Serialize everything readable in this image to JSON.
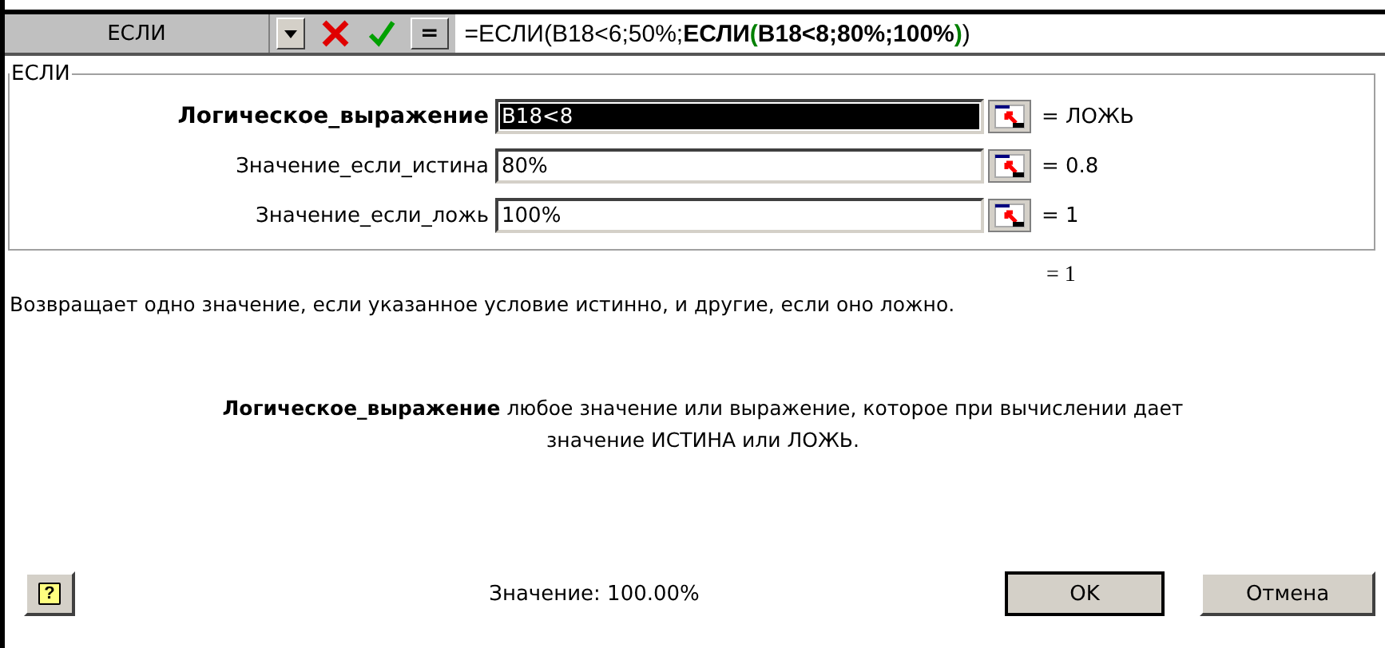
{
  "name_box": {
    "value": "ЕСЛИ"
  },
  "formula_bar": {
    "cancel_icon": true,
    "enter_icon": true,
    "equals": "=",
    "segments": [
      {
        "text": "=ЕСЛИ(B18<6;50%;",
        "bold": false
      },
      {
        "text": "ЕСЛИ",
        "bold": true
      },
      {
        "text": "(",
        "bold": true,
        "color": "#008000"
      },
      {
        "text": "B18<8;80%;100%",
        "bold": true
      },
      {
        "text": ")",
        "bold": true,
        "color": "#008000"
      },
      {
        "text": ")",
        "bold": false
      }
    ]
  },
  "group": {
    "title": "ЕСЛИ",
    "arguments": [
      {
        "label": "Логическое_выражение",
        "active": true,
        "value": "B18<8",
        "selected": true,
        "result": "= ЛОЖЬ"
      },
      {
        "label": "Значение_если_истина",
        "active": false,
        "value": "80%",
        "selected": false,
        "result": "= 0.8"
      },
      {
        "label": "Значение_если_ложь",
        "active": false,
        "value": "100%",
        "selected": false,
        "result": "= 1"
      }
    ]
  },
  "formula_result": "= 1",
  "description": "Возвращает одно значение, если указанное условие истинно, и другие, если оно ложно.",
  "argument_help": {
    "name": "Логическое_выражение",
    "text": "любое значение или выражение, которое при вычислении дает значение ИСТИНА или ЛОЖЬ."
  },
  "value_text": "Значение: 100.00%",
  "help_button": {
    "glyph": "?"
  },
  "buttons": [
    {
      "label": "OK",
      "default": true
    },
    {
      "label": "Отмена",
      "default": false
    }
  ]
}
